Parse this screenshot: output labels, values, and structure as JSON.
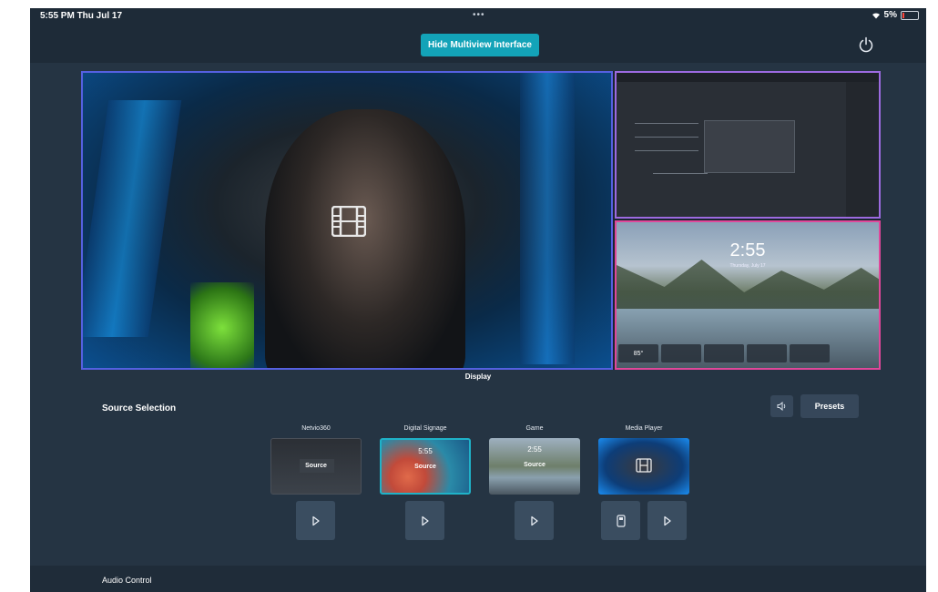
{
  "status_bar": {
    "time": "5:55 PM  Thu Jul 17",
    "dots": "•••",
    "battery": "5%"
  },
  "header": {
    "hide_button": "Hide Multiview Interface",
    "power_icon": "power-icon"
  },
  "multiview": {
    "display_label": "Display",
    "side_bottom_clock": "2:55",
    "side_bottom_date": "Thursday, July 17",
    "weather": "85°"
  },
  "source_selection": {
    "title": "Source Selection",
    "presets_label": "Presets",
    "volume_icon": "speaker-icon",
    "sources": [
      {
        "name": "Netvio360",
        "overlay": "Source",
        "selected": false
      },
      {
        "name": "Digital Signage",
        "overlay": "Source",
        "selected": true,
        "clock": "5:55"
      },
      {
        "name": "Game",
        "overlay": "Source",
        "selected": false,
        "clock": "2:55"
      },
      {
        "name": "Media Player",
        "overlay": "",
        "selected": false
      }
    ]
  },
  "audio": {
    "title": "Audio Control"
  },
  "colors": {
    "accent": "#13a3b8",
    "main_border": "#5560e0",
    "top_right_border": "#9c6ae0",
    "bottom_right_border": "#e0479a"
  }
}
